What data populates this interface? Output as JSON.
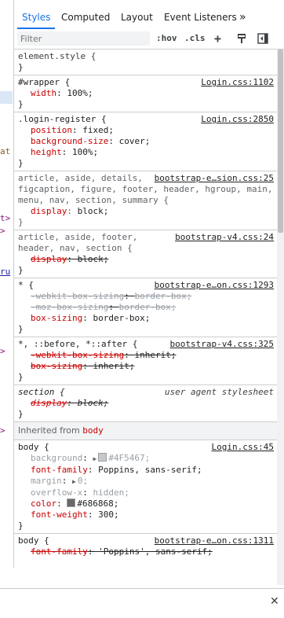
{
  "tabs": [
    {
      "label": "Styles"
    },
    {
      "label": "Computed"
    },
    {
      "label": "Layout"
    },
    {
      "label": "Event Listeners"
    },
    {
      "label": "»"
    }
  ],
  "filter": {
    "placeholder": "Filter",
    "hov": ":hov",
    "cls": ".cls",
    "add": "+"
  },
  "gutter": {
    "f1": "at",
    "f2": "t>",
    "f3": ">",
    "f4": "ru",
    "f5": ">",
    "f6": ">"
  },
  "rules": [
    {
      "selector": "element.style {",
      "source": "",
      "decls": [],
      "close": "}"
    },
    {
      "selector": "#wrapper {",
      "source": "Login.css:1102",
      "decls": [
        {
          "prop": "width",
          "val": "100%;"
        }
      ],
      "close": "}"
    },
    {
      "selector": ".login-register {",
      "source": "Login.css:2850",
      "decls": [
        {
          "prop": "position",
          "val": "fixed;"
        },
        {
          "prop": "background-size",
          "val": "cover;"
        },
        {
          "prop": "height",
          "val": "100%;"
        }
      ],
      "close": "}"
    },
    {
      "selector": "article, aside, details,",
      "selector2": "figcaption, figure, footer, header, hgroup, main,",
      "selector3": "menu, nav, section, summary {",
      "source": "bootstrap-e…sion.css:25",
      "decls": [
        {
          "prop": "display",
          "val": "block;"
        }
      ],
      "close": "}"
    },
    {
      "selector": "article, aside, footer,",
      "selector2": "header, nav, section {",
      "source": "bootstrap-v4.css:24",
      "decls": [
        {
          "prop": "display",
          "val": "block;"
        }
      ],
      "close": "}"
    },
    {
      "selector": "* {",
      "source": "bootstrap-e…on.css:1293",
      "decls": [
        {
          "prop": "-webkit-box-sizing",
          "val": "border-box;"
        },
        {
          "prop": "-moz-box-sizing",
          "val": "border-box;"
        },
        {
          "prop": "box-sizing",
          "val": "border-box;"
        }
      ],
      "close": "}"
    },
    {
      "selector": "*, ::before, *::after {",
      "source": "bootstrap-v4.css:325",
      "decls": [
        {
          "prop": "-webkit-box-sizing",
          "val": "inherit;"
        },
        {
          "prop": "box-sizing",
          "val": "inherit;"
        }
      ],
      "close": "}"
    },
    {
      "selector": "section {",
      "source": "user agent stylesheet",
      "decls": [
        {
          "prop": "display",
          "val": "block;"
        }
      ],
      "close": "}"
    }
  ],
  "inherited": {
    "label": "Inherited from",
    "tag": "body"
  },
  "body_rules": [
    {
      "selector": "body {",
      "source": "Login.css:45",
      "decls": [
        {
          "prop": "background",
          "val": "#4F5467;",
          "swatch": "#c8c8c8"
        },
        {
          "prop": "font-family",
          "val": "Poppins, sans-serif;"
        },
        {
          "prop": "margin",
          "val": "0;"
        },
        {
          "prop": "overflow-x",
          "val": "hidden;"
        },
        {
          "prop": "color",
          "val": "#686868;",
          "swatch": "#686868"
        },
        {
          "prop": "font-weight",
          "val": "300;"
        }
      ],
      "close": "}"
    },
    {
      "selector": "body {",
      "source": "bootstrap-e…on.css:1311",
      "decls": [
        {
          "prop": "font-family",
          "val": "'Poppins', sans-serif;"
        }
      ],
      "close": ""
    }
  ],
  "colors": {
    "accent": "#1a73e8",
    "prop": "#c80000",
    "border": "#cbcdd1"
  }
}
